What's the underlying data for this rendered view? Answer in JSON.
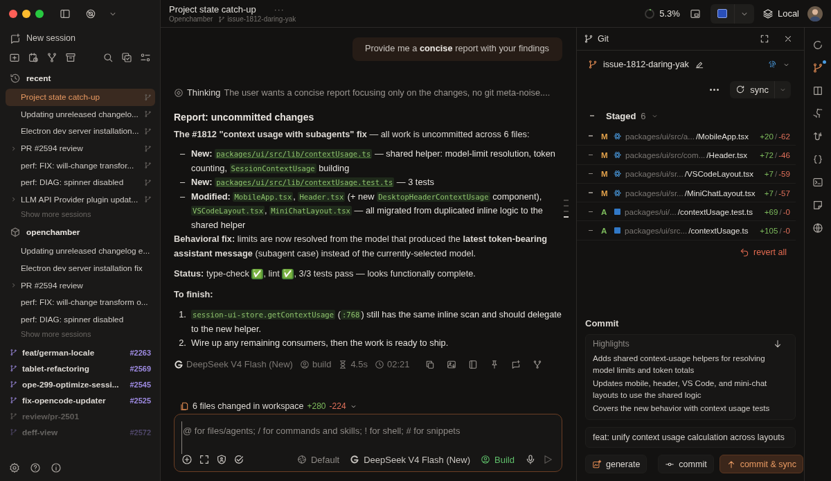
{
  "sidebar": {
    "new_session": "New session",
    "groups": [
      {
        "kind": "recent",
        "title": "recent",
        "show_more": "Show more sessions",
        "sessions": [
          {
            "title": "Project state catch-up",
            "selected": true,
            "expandable": false
          },
          {
            "title": "Updating unreleased changelo...",
            "selected": false,
            "expandable": false
          },
          {
            "title": "Electron dev server installation...",
            "selected": false,
            "expandable": false
          },
          {
            "title": "PR #2594 review",
            "selected": false,
            "expandable": true
          },
          {
            "title": "perf: FIX: will-change transfor...",
            "selected": false,
            "expandable": false
          },
          {
            "title": "perf: DIAG: spinner disabled",
            "selected": false,
            "expandable": false
          },
          {
            "title": "LLM API Provider plugin updat...",
            "selected": false,
            "expandable": true
          }
        ]
      },
      {
        "kind": "project",
        "title": "openchamber",
        "show_more": "Show more sessions",
        "sessions": [
          {
            "title": "Updating unreleased changelog e...",
            "selected": false,
            "expandable": false
          },
          {
            "title": "Electron dev server installation fix",
            "selected": false,
            "expandable": false
          },
          {
            "title": "PR #2594 review",
            "selected": false,
            "expandable": true
          },
          {
            "title": "perf: FIX: will-change transform o...",
            "selected": false,
            "expandable": false
          },
          {
            "title": "perf: DIAG: spinner disabled",
            "selected": false,
            "expandable": false
          }
        ]
      }
    ],
    "branches": [
      {
        "name": "feat/german-locale",
        "pr": "#2263"
      },
      {
        "name": "tablet-refactoring",
        "pr": "#2569"
      },
      {
        "name": "ope-299-optimize-sessi...",
        "pr": "#2545"
      },
      {
        "name": "fix-opencode-updater",
        "pr": "#2525"
      },
      {
        "name": "review/pr-2501"
      },
      {
        "name": "deff-view",
        "pr": "#2572"
      }
    ]
  },
  "header": {
    "title": "Project state catch-up",
    "project": "Openchamber",
    "branch": "issue-1812-daring-yak",
    "menu": "···",
    "context": {
      "level": 0.053,
      "label": "5.3%"
    },
    "environment": "Local"
  },
  "chat": {
    "user_message": "Provide me a **concise** report with your findings",
    "thinking": {
      "label": "Thinking",
      "text": "The user wants a concise report focusing only on the changes, no git meta-noise...."
    },
    "heading": "Report: uncommitted changes",
    "blocks": [
      {
        "kind": "paragraph",
        "parts": [
          {
            "kind": "text",
            "text": "**The #1812 \"context usage with subagents\" fix** — all work is uncommitted across 6 files:"
          }
        ]
      },
      {
        "kind": "list",
        "items": [
          {
            "marker": "–",
            "parts": [
              {
                "kind": "text",
                "text": "**New:** "
              },
              {
                "kind": "path",
                "text": "packages/ui/src/lib/contextUsage.ts"
              },
              {
                "kind": "text",
                "text": " — shared helper: model-limit resolution, token counting, "
              },
              {
                "kind": "code",
                "text": "SessionContextUsage"
              },
              {
                "kind": "text",
                "text": " building"
              }
            ]
          },
          {
            "marker": "–",
            "parts": [
              {
                "kind": "text",
                "text": "**New:** "
              },
              {
                "kind": "path",
                "text": "packages/ui/src/lib/contextUsage.test.ts"
              },
              {
                "kind": "text",
                "text": " — 3 tests"
              }
            ]
          },
          {
            "marker": "–",
            "parts": [
              {
                "kind": "text",
                "text": "**Modified:** "
              },
              {
                "kind": "code",
                "text": "MobileApp.tsx"
              },
              {
                "kind": "text",
                "text": ", "
              },
              {
                "kind": "code",
                "text": "Header.tsx"
              },
              {
                "kind": "text",
                "text": " (+ new "
              },
              {
                "kind": "code",
                "text": "DesktopHeaderContextUsage"
              },
              {
                "kind": "text",
                "text": " component), "
              },
              {
                "kind": "code",
                "text": "VSCodeLayout.tsx"
              },
              {
                "kind": "text",
                "text": ", "
              },
              {
                "kind": "code",
                "text": "MiniChatLayout.tsx"
              },
              {
                "kind": "text",
                "text": " — all migrated from duplicated inline logic to the shared helper"
              }
            ]
          }
        ]
      },
      {
        "kind": "tight",
        "parts": [
          {
            "kind": "text",
            "text": "**Behavioral fix:** limits are now resolved from the model that produced the **latest token-bearing assistant message** (subagent case) instead of the currently-selected model."
          }
        ]
      },
      {
        "kind": "paragraph",
        "parts": [
          {
            "kind": "text",
            "text": "**Status:** type-check "
          },
          {
            "kind": "emoji",
            "text": "✅"
          },
          {
            "kind": "text",
            "text": ", lint "
          },
          {
            "kind": "emoji",
            "text": "✅"
          },
          {
            "kind": "text",
            "text": ", 3/3 tests pass — looks functionally complete."
          }
        ]
      },
      {
        "kind": "subheading",
        "parts": [
          {
            "kind": "text",
            "text": "To finish:"
          }
        ]
      },
      {
        "kind": "list",
        "items": [
          {
            "marker": "1.",
            "parts": [
              {
                "kind": "code",
                "text": "session-ui-store.getContextUsage"
              },
              {
                "kind": "text",
                "text": " ("
              },
              {
                "kind": "code",
                "text": ":768"
              },
              {
                "kind": "text",
                "text": ") still has the same inline scan and should delegate to the new helper."
              }
            ]
          },
          {
            "marker": "2.",
            "parts": [
              {
                "kind": "text",
                "text": "Wire up any remaining consumers, then the work is ready to ship."
              }
            ]
          }
        ]
      }
    ],
    "meta": {
      "model": "DeepSeek V4 Flash (New)",
      "agent": "build",
      "duration": "4.5s",
      "time": "02:21"
    },
    "changes": {
      "label": "6 files changed in workspace",
      "added": "+280",
      "removed": "-224"
    },
    "composer": {
      "placeholder": "@ for files/agents; / for commands and skills; ! for shell; # for snippets",
      "variant": "Default",
      "model": "DeepSeek V4 Flash (New)",
      "agent": "Build"
    }
  },
  "git": {
    "title": "Git",
    "branch": "issue-1812-daring-yak",
    "sync": "sync",
    "staged": {
      "label": "Staged",
      "count": "6",
      "files": [
        {
          "status": "M",
          "kind": "modified",
          "dir": "packages/ui/src/a...",
          "name": "/MobileApp.tsx",
          "added": "+20",
          "separator": "/",
          "removed": "-62"
        },
        {
          "status": "M",
          "kind": "modified",
          "dir": "packages/ui/src/com...",
          "name": "/Header.tsx",
          "added": "+72",
          "separator": "/",
          "removed": "-46"
        },
        {
          "status": "M",
          "kind": "modified",
          "dir": "packages/ui/sr...",
          "name": "/VSCodeLayout.tsx",
          "added": "+7",
          "separator": "/",
          "removed": "-59"
        },
        {
          "status": "M",
          "kind": "modified",
          "dir": "packages/ui/sr...",
          "name": "/MiniChatLayout.tsx",
          "added": "+7",
          "separator": "/",
          "removed": "-57"
        },
        {
          "status": "A",
          "kind": "added",
          "dir": "packages/ui/...",
          "name": "/contextUsage.test.ts",
          "added": "+69",
          "separator": "/",
          "removed": "-0"
        },
        {
          "status": "A",
          "kind": "added",
          "dir": "packages/ui/src...",
          "name": "/contextUsage.ts",
          "added": "+105",
          "separator": "/",
          "removed": "-0"
        }
      ]
    },
    "revert": "revert all",
    "commit": {
      "heading": "Commit",
      "highlights_label": "Highlights",
      "highlights": [
        "Adds shared context-usage helpers for resolving model limits and token totals",
        "Updates mobile, header, VS Code, and mini-chat layouts to use the shared logic",
        "Covers the new behavior with context usage tests"
      ],
      "message": "feat: unify context usage calculation across layouts",
      "buttons": [
        {
          "label": "generate",
          "kind": "generate"
        },
        {
          "label": "commit",
          "kind": "commit"
        },
        {
          "label": "commit & sync",
          "kind": "primary"
        }
      ]
    }
  },
  "rail": [
    {
      "selected": false
    },
    {
      "selected": true,
      "notification": true
    },
    {
      "selected": false
    },
    {
      "selected": false
    },
    {
      "selected": false
    },
    {
      "selected": false
    },
    {
      "selected": false
    },
    {
      "selected": false
    },
    {
      "selected": false
    }
  ]
}
